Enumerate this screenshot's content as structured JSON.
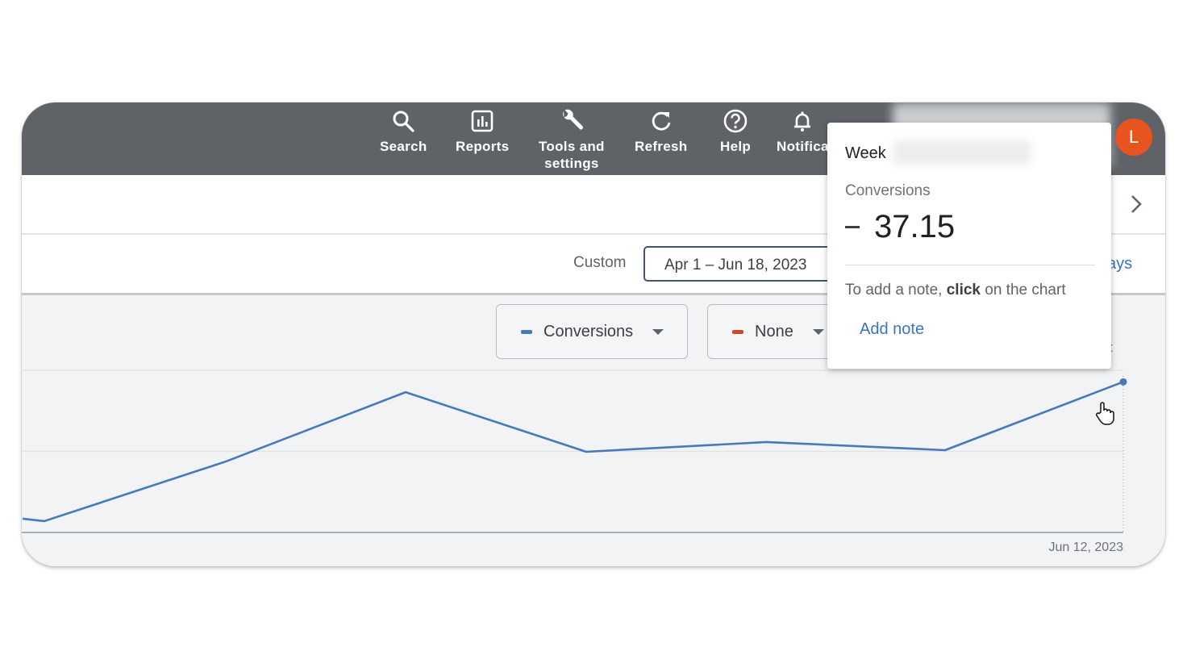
{
  "topnav": {
    "items": [
      {
        "label": "Search",
        "icon": "search-icon"
      },
      {
        "label": "Reports",
        "icon": "reports-icon"
      },
      {
        "label": "Tools and\nsettings",
        "label_line1": "Tools and",
        "label_line2": "settings",
        "icon": "wrench-icon"
      },
      {
        "label": "Refresh",
        "icon": "refresh-icon"
      },
      {
        "label": "Help",
        "icon": "help-icon"
      },
      {
        "label": "Notifica",
        "icon": "bell-icon"
      }
    ],
    "avatar_initial": "L",
    "avatar_color": "#e8541f"
  },
  "date_range": {
    "preset_label": "Custom",
    "value": "Apr 1 – Jun 18, 2023",
    "partial_link": "ays"
  },
  "chart_controls": {
    "metric1": {
      "label": "Conversions",
      "color": "#4a78bb"
    },
    "metric2": {
      "label": "None",
      "color": "#d2462c"
    },
    "adjust_partial": "ust"
  },
  "tooltip": {
    "week_label": "Week",
    "metric_label": "Conversions",
    "value": "37.15",
    "hint_pre": "To add a note, ",
    "hint_bold": "click",
    "hint_post": " on the chart",
    "add_note": "Add note"
  },
  "chart_data": {
    "type": "line",
    "title": "",
    "xlabel": "",
    "ylabel": "",
    "x_tick_labels": [
      "Jun 12, 2023"
    ],
    "series": [
      {
        "name": "Conversions",
        "color": "#4a78bb",
        "values": [
          3.4,
          2.8,
          17.5,
          34.6,
          19.9,
          22.3,
          20.3,
          37.15
        ]
      }
    ],
    "ylim": [
      0,
      40
    ],
    "gridlines": [
      0,
      20,
      40
    ],
    "grid": true,
    "legend": "none"
  }
}
